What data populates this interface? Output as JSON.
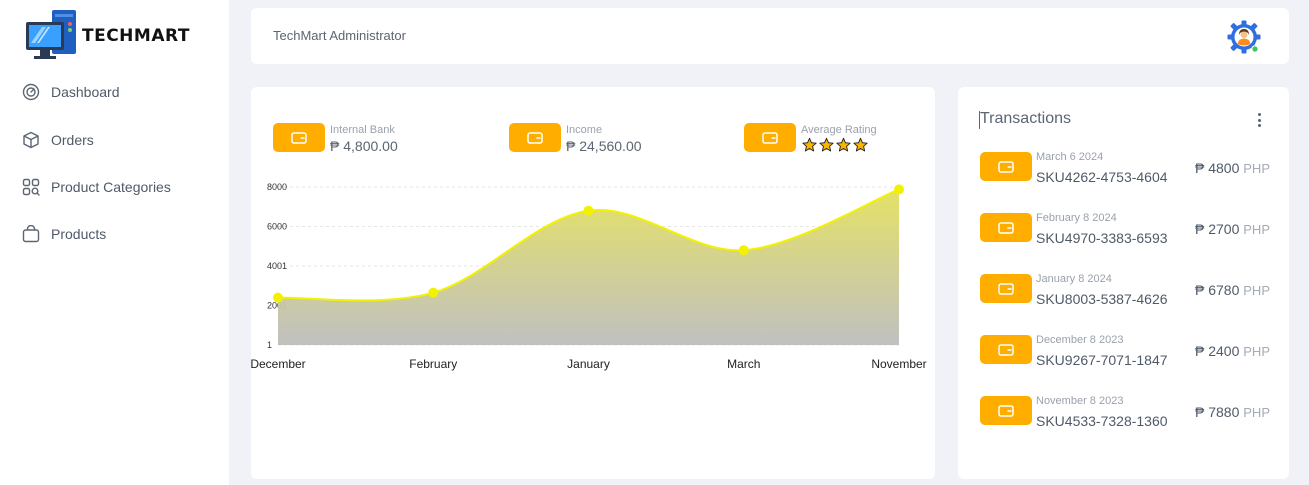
{
  "brand": {
    "name": "TECHMART"
  },
  "sidebar": {
    "items": [
      {
        "label": "Dashboard",
        "icon": "dashboard-gauge-icon"
      },
      {
        "label": "Orders",
        "icon": "box-icon"
      },
      {
        "label": "Product Categories",
        "icon": "categories-grid-search-icon"
      },
      {
        "label": "Products",
        "icon": "shopping-bag-icon"
      }
    ]
  },
  "header": {
    "title": "TechMart Administrator",
    "avatar_icon": "user-gear-avatar-icon"
  },
  "stats": [
    {
      "label": "Internal Bank",
      "value": "₱ 4,800.00",
      "icon": "wallet-icon"
    },
    {
      "label": "Income",
      "value": "₱ 24,560.00",
      "icon": "wallet-icon"
    },
    {
      "label": "Average Rating",
      "rating": 4,
      "icon": "wallet-icon"
    }
  ],
  "colors": {
    "accent": "#ffae00",
    "line": "#f2f200",
    "fill_top": "#e3e05e",
    "fill_bottom": "#bdbdbd",
    "online": "#3cc552"
  },
  "chart_data": {
    "type": "area",
    "categories": [
      "December",
      "February",
      "January",
      "March",
      "November"
    ],
    "values": [
      2400,
      2650,
      6800,
      4800,
      7880
    ],
    "y_ticks": [
      "1",
      "2001",
      "4001",
      "6000",
      "8000"
    ],
    "ylim": [
      1,
      8000
    ],
    "grid": "horizontal-dashed",
    "legend": "none"
  },
  "transactions": {
    "title": "Transactions",
    "currency_label": "PHP",
    "items": [
      {
        "date": "March 6 2024",
        "sku": "SKU4262-4753-4604",
        "amount": "₱ 4800"
      },
      {
        "date": "February 8 2024",
        "sku": "SKU4970-3383-6593",
        "amount": "₱ 2700"
      },
      {
        "date": "January 8 2024",
        "sku": "SKU8003-5387-4626",
        "amount": "₱ 6780"
      },
      {
        "date": "December 8 2023",
        "sku": "SKU9267-7071-1847",
        "amount": "₱ 2400"
      },
      {
        "date": "November 8 2023",
        "sku": "SKU4533-7328-1360",
        "amount": "₱ 7880"
      }
    ]
  }
}
